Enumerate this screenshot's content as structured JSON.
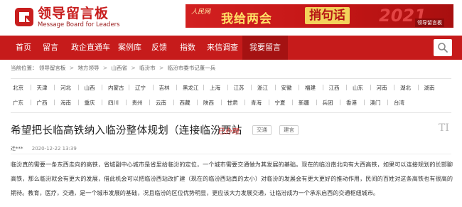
{
  "header": {
    "logo_title": "领导留言板",
    "logo_subtitle": "Message Board for Leaders",
    "banner": {
      "brand": "人民网",
      "text_main": "我给两会",
      "text_highlight": "捎句话",
      "year_art": "2021",
      "badge": "领导留言板"
    }
  },
  "nav": {
    "items": [
      "首页",
      "留言",
      "政企直通车",
      "案例库",
      "反馈",
      "指数",
      "来信调查",
      "我要留言"
    ],
    "active_index": 7
  },
  "breadcrumb": {
    "prefix": "当前位置：",
    "items": [
      "领导留言板",
      "地方领导",
      "山西省",
      "临汾市",
      "临汾市委书记董一兵"
    ],
    "separator": ">"
  },
  "provinces": {
    "row1": [
      "北京",
      "天津",
      "河北",
      "山西",
      "内蒙古",
      "辽宁",
      "吉林",
      "黑龙江",
      "上海",
      "江苏",
      "浙江",
      "安徽",
      "福建",
      "江西",
      "山东",
      "河南",
      "湖北",
      "湖南"
    ],
    "row2": [
      "广东",
      "广西",
      "海南",
      "重庆",
      "四川",
      "贵州",
      "云南",
      "西藏",
      "陕西",
      "甘肃",
      "青海",
      "宁夏",
      "新疆",
      "兵团",
      "香港",
      "澳门",
      "台湾"
    ]
  },
  "message": {
    "title": "希望把长临高铁纳入临汾整体规划（连接临汾西站",
    "status": "已办理",
    "tags": [
      "交通",
      "建言"
    ],
    "font_toggle": "TI",
    "author": "迁***",
    "datetime": "2020-12-22 13:39",
    "body": "临汾真的需要一条东西走向的高铁，省城副中心城市是省里给临汾的定位，一个城市需要交通做为其发展的基础。现在的临汾南北向有大西高铁，如果可以连接规划的长邯聊高铁，那么临汾就会有更大的发展，借此机会可以把临汾西站改扩建（现在的临汾西站真的太小）对临汾的发展会有更大更好的推动作用，民间的百姓对这条高铁也有很高的期待。教育，医疗，交通，是一个城市发展的基础，况且临汾的区位优势明显，更应该大力发展交通，让临汾成为一个承东启西的交通枢纽城市。"
  },
  "colors": {
    "brand_red": "#c61b1b",
    "nav_active": "#a51212",
    "status_red": "#d83a3a"
  }
}
